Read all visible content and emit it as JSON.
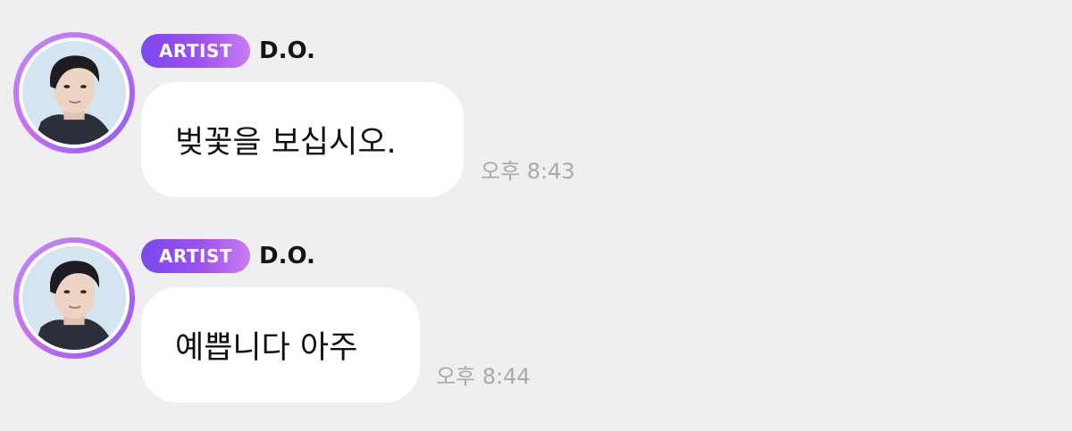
{
  "messages": [
    {
      "badge": "ARTIST",
      "sender": "D.O.",
      "text": "벚꽃을 보십시오.",
      "time": "오후 8:43",
      "avatar_icon": "profile-photo"
    },
    {
      "badge": "ARTIST",
      "sender": "D.O.",
      "text": "예쁩니다 아주",
      "time": "오후 8:44",
      "avatar_icon": "profile-photo"
    }
  ],
  "colors": {
    "background": "#efeef0",
    "badge_start": "#7a48f0",
    "badge_end": "#c97bf4",
    "avatar_ring": "#b58cf6",
    "bubble": "#ffffff",
    "time_text": "#a9a9ab"
  }
}
